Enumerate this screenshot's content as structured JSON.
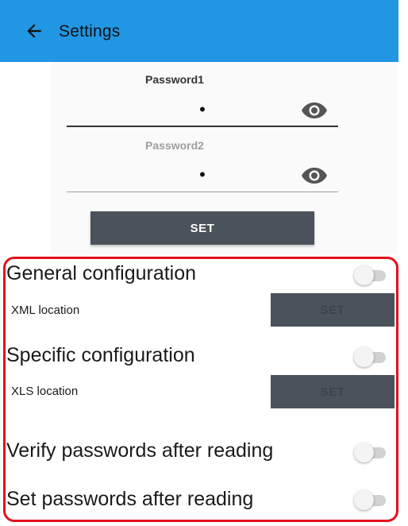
{
  "app_bar": {
    "title": "Settings",
    "color": "#2196e3"
  },
  "password_panel": {
    "password1": {
      "label": "Password1",
      "value": "•"
    },
    "password2": {
      "label": "Password2",
      "value": "•"
    },
    "set_label": "SET"
  },
  "config": {
    "general": {
      "label": "General configuration",
      "enabled": false
    },
    "xml": {
      "label": "XML location",
      "set_label": "SET"
    },
    "specific": {
      "label": "Specific configuration",
      "enabled": false
    },
    "xls": {
      "label": "XLS location",
      "set_label": "SET"
    },
    "verify": {
      "label": "Verify passwords after reading",
      "enabled": false
    },
    "set_after": {
      "label": "Set passwords after reading",
      "enabled": false
    },
    "highlight_color": "#e3101c"
  },
  "icons": [
    "back-arrow-icon",
    "eye-icon",
    "eye-icon"
  ]
}
